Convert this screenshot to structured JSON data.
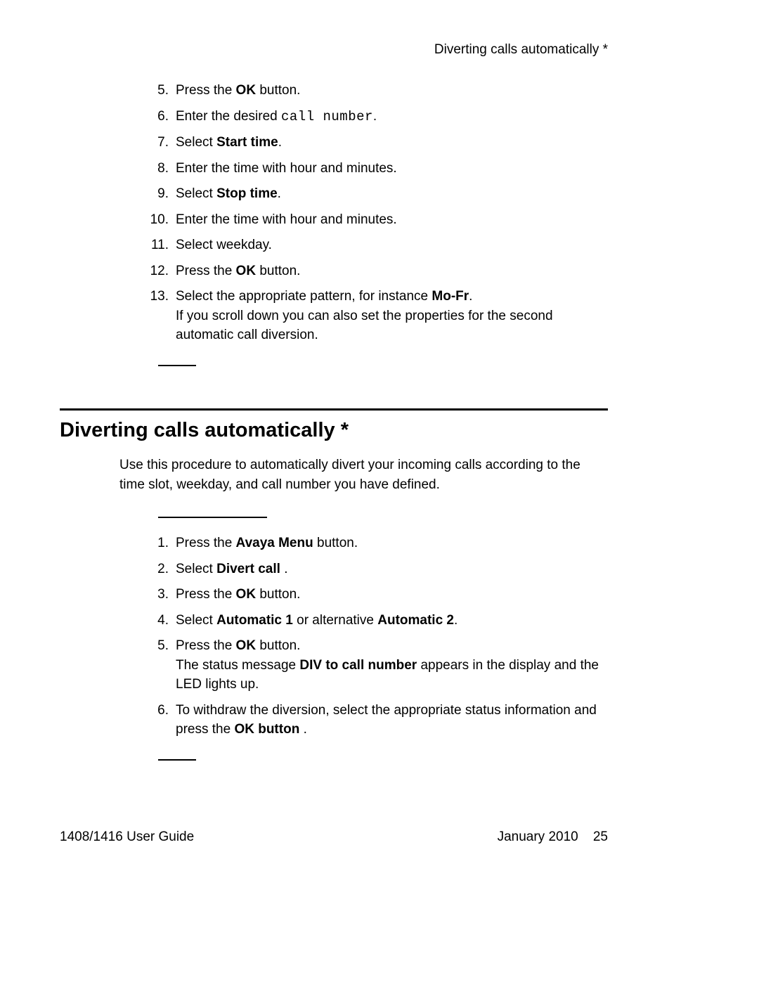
{
  "header": {
    "running_title": "Diverting calls automatically *"
  },
  "list1": {
    "items": [
      {
        "num": "5.",
        "parts": [
          {
            "t": "Press the "
          },
          {
            "t": "OK",
            "b": true
          },
          {
            "t": " button."
          }
        ]
      },
      {
        "num": "6.",
        "parts": [
          {
            "t": "Enter the desired "
          },
          {
            "t": "call number",
            "mono": true
          },
          {
            "t": "."
          }
        ]
      },
      {
        "num": "7.",
        "parts": [
          {
            "t": "Select "
          },
          {
            "t": "Start time",
            "b": true
          },
          {
            "t": "."
          }
        ]
      },
      {
        "num": "8.",
        "parts": [
          {
            "t": "Enter the time with hour and minutes."
          }
        ]
      },
      {
        "num": "9.",
        "parts": [
          {
            "t": "Select "
          },
          {
            "t": "Stop time",
            "b": true
          },
          {
            "t": "."
          }
        ]
      },
      {
        "num": "10.",
        "parts": [
          {
            "t": "Enter the time with hour and minutes."
          }
        ]
      },
      {
        "num": "11.",
        "parts": [
          {
            "t": "Select weekday."
          }
        ]
      },
      {
        "num": "12.",
        "parts": [
          {
            "t": "Press the "
          },
          {
            "t": "OK",
            "b": true
          },
          {
            "t": " button."
          }
        ]
      },
      {
        "num": "13.",
        "parts": [
          {
            "t": "Select the appropriate pattern, for instance "
          },
          {
            "t": "Mo-Fr",
            "b": true
          },
          {
            "t": "."
          },
          {
            "br": true
          },
          {
            "t": "If you scroll down you can also set the properties for the second automatic call diversion."
          }
        ]
      }
    ]
  },
  "section": {
    "title": "Diverting calls automatically *",
    "intro": "Use this procedure to automatically divert your incoming calls according to the time slot, weekday, and call number you have defined."
  },
  "list2": {
    "items": [
      {
        "num": "1.",
        "parts": [
          {
            "t": "Press the "
          },
          {
            "t": "Avaya Menu",
            "b": true
          },
          {
            "t": " button."
          }
        ]
      },
      {
        "num": "2.",
        "parts": [
          {
            "t": "Select "
          },
          {
            "t": "Divert call",
            "b": true
          },
          {
            "t": " ."
          }
        ]
      },
      {
        "num": "3.",
        "parts": [
          {
            "t": "Press the "
          },
          {
            "t": "OK",
            "b": true
          },
          {
            "t": " button."
          }
        ]
      },
      {
        "num": "4.",
        "parts": [
          {
            "t": "Select "
          },
          {
            "t": "Automatic 1",
            "b": true
          },
          {
            "t": " or alternative "
          },
          {
            "t": "Automatic 2",
            "b": true
          },
          {
            "t": "."
          }
        ]
      },
      {
        "num": "5.",
        "parts": [
          {
            "t": "Press the "
          },
          {
            "t": "OK",
            "b": true
          },
          {
            "t": " button."
          },
          {
            "br": true
          },
          {
            "t": "The status message "
          },
          {
            "t": "DIV to call number",
            "b": true
          },
          {
            "t": " appears in the display and the LED lights up."
          }
        ]
      },
      {
        "num": "6.",
        "parts": [
          {
            "t": "To withdraw the diversion, select the appropriate status information and press the "
          },
          {
            "t": "OK button",
            "b": true
          },
          {
            "t": " ."
          }
        ]
      }
    ]
  },
  "footer": {
    "left": "1408/1416 User Guide",
    "right_date": "January 2010",
    "page_num": "25"
  }
}
